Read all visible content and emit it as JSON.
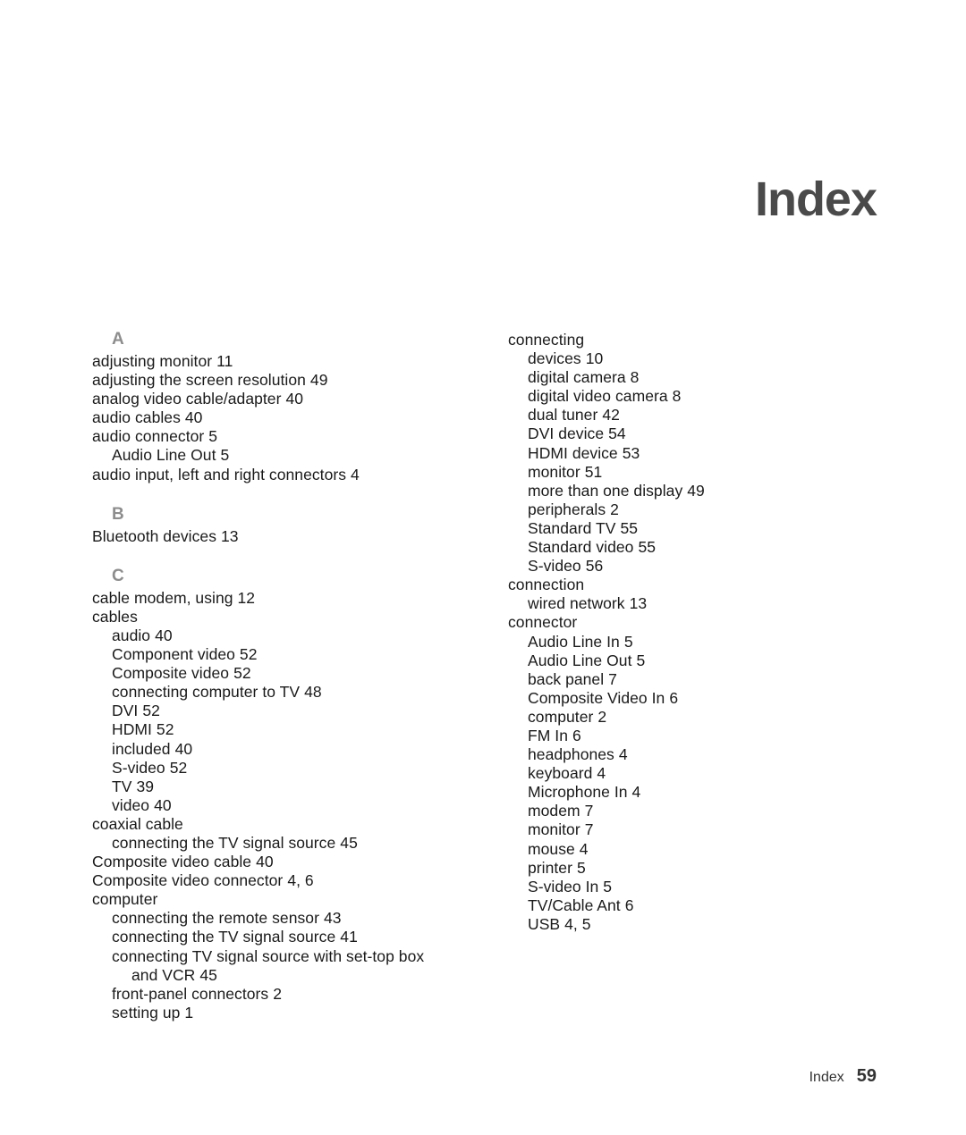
{
  "document": {
    "title": "Index",
    "footer": {
      "label": "Index",
      "page_number": "59"
    },
    "colors": {
      "letter_heading": "#8d8d8d",
      "body_text": "#1a1a1a",
      "title": "#4a4a4a",
      "footer": "#333333",
      "background": "#ffffff"
    }
  },
  "columns": [
    {
      "name": "left-column",
      "groups": [
        {
          "letter": "A",
          "entries": [
            {
              "level": 1,
              "text": "adjusting monitor",
              "pages": "11"
            },
            {
              "level": 1,
              "text": "adjusting the screen resolution",
              "pages": "49"
            },
            {
              "level": 1,
              "text": "analog video cable/adapter",
              "pages": "40"
            },
            {
              "level": 1,
              "text": "audio cables",
              "pages": "40"
            },
            {
              "level": 1,
              "text": "audio connector",
              "pages": "5"
            },
            {
              "level": 2,
              "text": "Audio Line Out",
              "pages": "5"
            },
            {
              "level": 1,
              "text": "audio input, left and right connectors",
              "pages": "4"
            }
          ]
        },
        {
          "letter": "B",
          "entries": [
            {
              "level": 1,
              "text": "Bluetooth devices",
              "pages": "13"
            }
          ]
        },
        {
          "letter": "C",
          "entries": [
            {
              "level": 1,
              "text": "cable modem, using",
              "pages": "12"
            },
            {
              "level": 1,
              "text": "cables",
              "pages": ""
            },
            {
              "level": 2,
              "text": "audio",
              "pages": "40"
            },
            {
              "level": 2,
              "text": "Component video",
              "pages": "52"
            },
            {
              "level": 2,
              "text": "Composite video",
              "pages": "52"
            },
            {
              "level": 2,
              "text": "connecting computer to TV",
              "pages": "48"
            },
            {
              "level": 2,
              "text": "DVI",
              "pages": "52"
            },
            {
              "level": 2,
              "text": "HDMI",
              "pages": "52"
            },
            {
              "level": 2,
              "text": "included",
              "pages": "40"
            },
            {
              "level": 2,
              "text": "S-video",
              "pages": "52"
            },
            {
              "level": 2,
              "text": "TV",
              "pages": "39"
            },
            {
              "level": 2,
              "text": "video",
              "pages": "40"
            },
            {
              "level": 1,
              "text": "coaxial cable",
              "pages": ""
            },
            {
              "level": 2,
              "text": "connecting the TV signal source",
              "pages": "45"
            },
            {
              "level": 1,
              "text": "Composite video cable",
              "pages": "40"
            },
            {
              "level": 1,
              "text": "Composite video connector",
              "pages": "4, 6"
            },
            {
              "level": 1,
              "text": "computer",
              "pages": ""
            },
            {
              "level": 2,
              "text": "connecting the remote sensor",
              "pages": "43"
            },
            {
              "level": 2,
              "text": "connecting the TV signal source",
              "pages": "41"
            },
            {
              "level": 2,
              "text": "connecting TV signal source with set-top box",
              "continuation": "and VCR",
              "pages": "45",
              "wrapped": true
            },
            {
              "level": 2,
              "text": "front-panel connectors",
              "pages": "2"
            },
            {
              "level": 2,
              "text": "setting up",
              "pages": "1"
            }
          ]
        }
      ]
    },
    {
      "name": "right-column",
      "groups": [
        {
          "letter": "",
          "entries": [
            {
              "level": 1,
              "text": "connecting",
              "pages": ""
            },
            {
              "level": 2,
              "text": "devices",
              "pages": "10"
            },
            {
              "level": 2,
              "text": "digital camera",
              "pages": "8"
            },
            {
              "level": 2,
              "text": "digital video camera",
              "pages": "8"
            },
            {
              "level": 2,
              "text": "dual tuner",
              "pages": "42"
            },
            {
              "level": 2,
              "text": "DVI device",
              "pages": "54"
            },
            {
              "level": 2,
              "text": "HDMI device",
              "pages": "53"
            },
            {
              "level": 2,
              "text": "monitor",
              "pages": "51"
            },
            {
              "level": 2,
              "text": "more than one display",
              "pages": "49"
            },
            {
              "level": 2,
              "text": "peripherals",
              "pages": "2"
            },
            {
              "level": 2,
              "text": "Standard TV",
              "pages": "55"
            },
            {
              "level": 2,
              "text": "Standard video",
              "pages": "55"
            },
            {
              "level": 2,
              "text": "S-video",
              "pages": "56"
            },
            {
              "level": 1,
              "text": "connection",
              "pages": ""
            },
            {
              "level": 2,
              "text": "wired network",
              "pages": "13"
            },
            {
              "level": 1,
              "text": "connector",
              "pages": ""
            },
            {
              "level": 2,
              "text": "Audio Line In",
              "pages": "5"
            },
            {
              "level": 2,
              "text": "Audio Line Out",
              "pages": "5"
            },
            {
              "level": 2,
              "text": "back panel",
              "pages": "7"
            },
            {
              "level": 2,
              "text": "Composite Video In",
              "pages": "6"
            },
            {
              "level": 2,
              "text": "computer",
              "pages": "2"
            },
            {
              "level": 2,
              "text": "FM In",
              "pages": "6"
            },
            {
              "level": 2,
              "text": "headphones",
              "pages": "4"
            },
            {
              "level": 2,
              "text": "keyboard",
              "pages": "4"
            },
            {
              "level": 2,
              "text": "Microphone In",
              "pages": "4"
            },
            {
              "level": 2,
              "text": "modem",
              "pages": "7"
            },
            {
              "level": 2,
              "text": "monitor",
              "pages": "7"
            },
            {
              "level": 2,
              "text": "mouse",
              "pages": "4"
            },
            {
              "level": 2,
              "text": "printer",
              "pages": "5"
            },
            {
              "level": 2,
              "text": "S-video In",
              "pages": "5"
            },
            {
              "level": 2,
              "text": "TV/Cable Ant",
              "pages": "6"
            },
            {
              "level": 2,
              "text": "USB",
              "pages": "4, 5"
            }
          ]
        }
      ]
    }
  ]
}
